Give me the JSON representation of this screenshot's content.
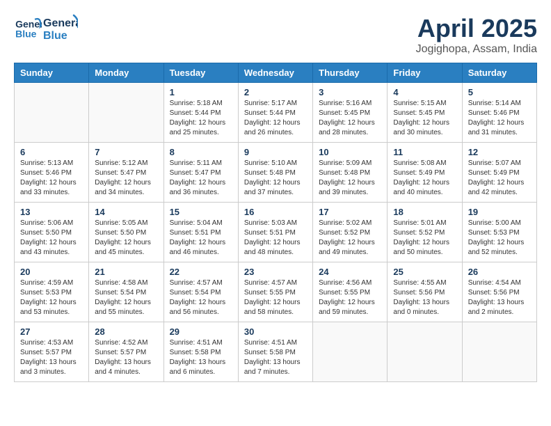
{
  "header": {
    "logo_line1": "General",
    "logo_line2": "Blue",
    "month_title": "April 2025",
    "subtitle": "Jogighopa, Assam, India"
  },
  "weekdays": [
    "Sunday",
    "Monday",
    "Tuesday",
    "Wednesday",
    "Thursday",
    "Friday",
    "Saturday"
  ],
  "weeks": [
    [
      {
        "day": "",
        "info": ""
      },
      {
        "day": "",
        "info": ""
      },
      {
        "day": "1",
        "info": "Sunrise: 5:18 AM\nSunset: 5:44 PM\nDaylight: 12 hours and 25 minutes."
      },
      {
        "day": "2",
        "info": "Sunrise: 5:17 AM\nSunset: 5:44 PM\nDaylight: 12 hours and 26 minutes."
      },
      {
        "day": "3",
        "info": "Sunrise: 5:16 AM\nSunset: 5:45 PM\nDaylight: 12 hours and 28 minutes."
      },
      {
        "day": "4",
        "info": "Sunrise: 5:15 AM\nSunset: 5:45 PM\nDaylight: 12 hours and 30 minutes."
      },
      {
        "day": "5",
        "info": "Sunrise: 5:14 AM\nSunset: 5:46 PM\nDaylight: 12 hours and 31 minutes."
      }
    ],
    [
      {
        "day": "6",
        "info": "Sunrise: 5:13 AM\nSunset: 5:46 PM\nDaylight: 12 hours and 33 minutes."
      },
      {
        "day": "7",
        "info": "Sunrise: 5:12 AM\nSunset: 5:47 PM\nDaylight: 12 hours and 34 minutes."
      },
      {
        "day": "8",
        "info": "Sunrise: 5:11 AM\nSunset: 5:47 PM\nDaylight: 12 hours and 36 minutes."
      },
      {
        "day": "9",
        "info": "Sunrise: 5:10 AM\nSunset: 5:48 PM\nDaylight: 12 hours and 37 minutes."
      },
      {
        "day": "10",
        "info": "Sunrise: 5:09 AM\nSunset: 5:48 PM\nDaylight: 12 hours and 39 minutes."
      },
      {
        "day": "11",
        "info": "Sunrise: 5:08 AM\nSunset: 5:49 PM\nDaylight: 12 hours and 40 minutes."
      },
      {
        "day": "12",
        "info": "Sunrise: 5:07 AM\nSunset: 5:49 PM\nDaylight: 12 hours and 42 minutes."
      }
    ],
    [
      {
        "day": "13",
        "info": "Sunrise: 5:06 AM\nSunset: 5:50 PM\nDaylight: 12 hours and 43 minutes."
      },
      {
        "day": "14",
        "info": "Sunrise: 5:05 AM\nSunset: 5:50 PM\nDaylight: 12 hours and 45 minutes."
      },
      {
        "day": "15",
        "info": "Sunrise: 5:04 AM\nSunset: 5:51 PM\nDaylight: 12 hours and 46 minutes."
      },
      {
        "day": "16",
        "info": "Sunrise: 5:03 AM\nSunset: 5:51 PM\nDaylight: 12 hours and 48 minutes."
      },
      {
        "day": "17",
        "info": "Sunrise: 5:02 AM\nSunset: 5:52 PM\nDaylight: 12 hours and 49 minutes."
      },
      {
        "day": "18",
        "info": "Sunrise: 5:01 AM\nSunset: 5:52 PM\nDaylight: 12 hours and 50 minutes."
      },
      {
        "day": "19",
        "info": "Sunrise: 5:00 AM\nSunset: 5:53 PM\nDaylight: 12 hours and 52 minutes."
      }
    ],
    [
      {
        "day": "20",
        "info": "Sunrise: 4:59 AM\nSunset: 5:53 PM\nDaylight: 12 hours and 53 minutes."
      },
      {
        "day": "21",
        "info": "Sunrise: 4:58 AM\nSunset: 5:54 PM\nDaylight: 12 hours and 55 minutes."
      },
      {
        "day": "22",
        "info": "Sunrise: 4:57 AM\nSunset: 5:54 PM\nDaylight: 12 hours and 56 minutes."
      },
      {
        "day": "23",
        "info": "Sunrise: 4:57 AM\nSunset: 5:55 PM\nDaylight: 12 hours and 58 minutes."
      },
      {
        "day": "24",
        "info": "Sunrise: 4:56 AM\nSunset: 5:55 PM\nDaylight: 12 hours and 59 minutes."
      },
      {
        "day": "25",
        "info": "Sunrise: 4:55 AM\nSunset: 5:56 PM\nDaylight: 13 hours and 0 minutes."
      },
      {
        "day": "26",
        "info": "Sunrise: 4:54 AM\nSunset: 5:56 PM\nDaylight: 13 hours and 2 minutes."
      }
    ],
    [
      {
        "day": "27",
        "info": "Sunrise: 4:53 AM\nSunset: 5:57 PM\nDaylight: 13 hours and 3 minutes."
      },
      {
        "day": "28",
        "info": "Sunrise: 4:52 AM\nSunset: 5:57 PM\nDaylight: 13 hours and 4 minutes."
      },
      {
        "day": "29",
        "info": "Sunrise: 4:51 AM\nSunset: 5:58 PM\nDaylight: 13 hours and 6 minutes."
      },
      {
        "day": "30",
        "info": "Sunrise: 4:51 AM\nSunset: 5:58 PM\nDaylight: 13 hours and 7 minutes."
      },
      {
        "day": "",
        "info": ""
      },
      {
        "day": "",
        "info": ""
      },
      {
        "day": "",
        "info": ""
      }
    ]
  ]
}
